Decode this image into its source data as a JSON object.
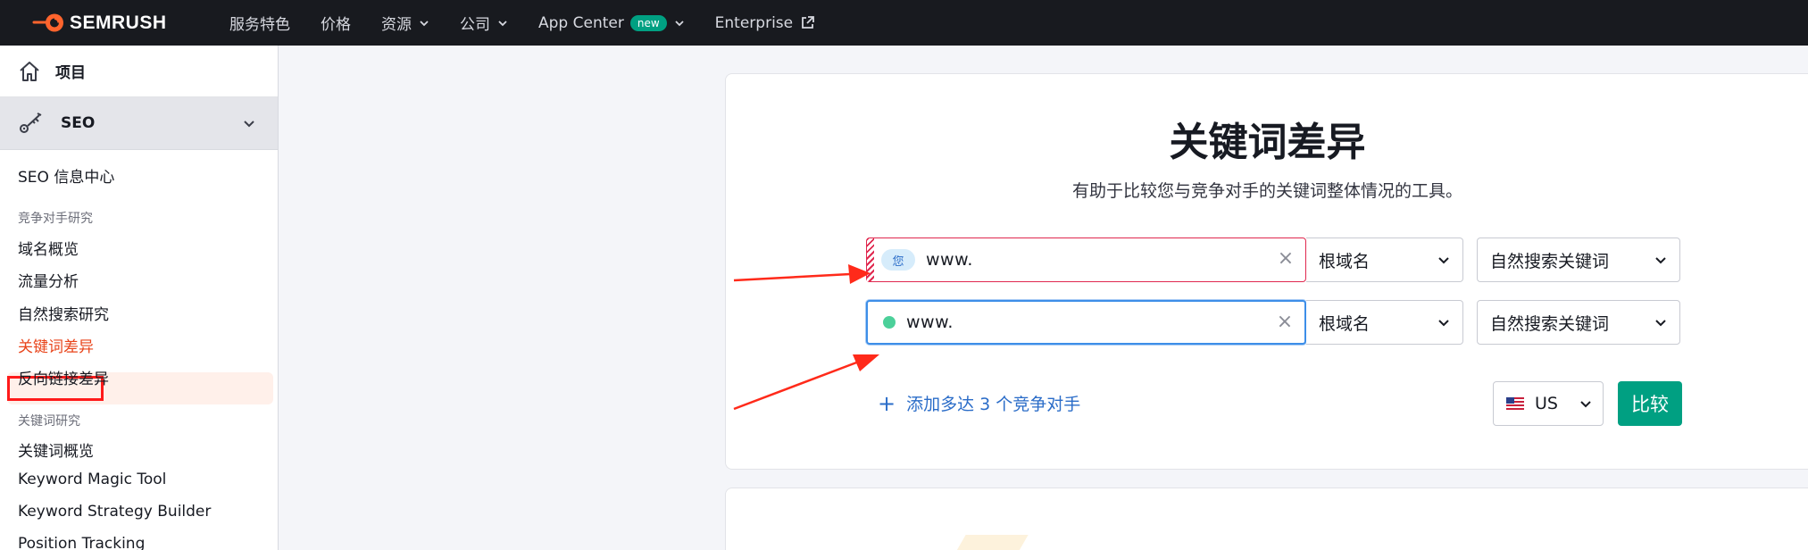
{
  "brand": {
    "name": "SEMRUSH",
    "accent": "#ff642d",
    "topbar_bg": "#181a1f",
    "primary_green": "#00a082"
  },
  "topnav": {
    "items": [
      {
        "label": "服务特色",
        "dropdown": false
      },
      {
        "label": "价格",
        "dropdown": false
      },
      {
        "label": "资源",
        "dropdown": true
      },
      {
        "label": "公司",
        "dropdown": true
      },
      {
        "label": "App Center",
        "dropdown": true,
        "badge": "new"
      },
      {
        "label": "Enterprise",
        "external": true
      }
    ]
  },
  "sidebar": {
    "projects_label": "项目",
    "seo_label": "SEO",
    "items": {
      "seo_hub": "SEO 信息中心",
      "section_competitive": "竞争对手研究",
      "domain_overview": "域名概览",
      "traffic_analytics": "流量分析",
      "organic_research": "自然搜索研究",
      "keyword_gap": "关键词差异",
      "backlink_gap": "反向链接差异",
      "section_keyword": "关键词研究",
      "keyword_overview": "关键词概览",
      "keyword_magic_tool": "Keyword Magic Tool",
      "keyword_strategy_builder": "Keyword Strategy Builder",
      "position_tracking": "Position Tracking"
    },
    "active_item": "关键词差异"
  },
  "main": {
    "title": "关键词差异",
    "subtitle": "有助于比较您与竞争对手的关键词整体情况的工具。",
    "rows": [
      {
        "badge": "您",
        "domain_value": "www.",
        "scope": "根域名",
        "keyword_type": "自然搜索关键词"
      },
      {
        "domain_value": "www.",
        "scope": "根域名",
        "keyword_type": "自然搜索关键词"
      }
    ],
    "clear_glyph": "×",
    "add_competitors_label": "添加多达 3 个竞争对手",
    "add_plus": "+",
    "country": "US",
    "compare_label": "比较"
  }
}
